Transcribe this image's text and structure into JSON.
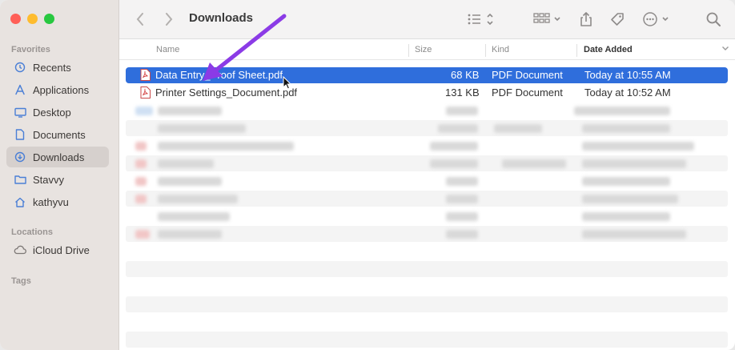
{
  "window": {
    "title": "Downloads"
  },
  "colors": {
    "selection": "#2f6edc",
    "arrow": "#8b3be6"
  },
  "sidebar": {
    "favorites_title": "Favorites",
    "favorites": [
      {
        "label": "Recents",
        "icon": "clock-icon"
      },
      {
        "label": "Applications",
        "icon": "applications-icon"
      },
      {
        "label": "Desktop",
        "icon": "desktop-icon"
      },
      {
        "label": "Documents",
        "icon": "document-icon"
      },
      {
        "label": "Downloads",
        "icon": "download-icon",
        "selected": true
      },
      {
        "label": "Stavvy",
        "icon": "folder-icon"
      },
      {
        "label": "kathyvu",
        "icon": "home-icon"
      }
    ],
    "locations_title": "Locations",
    "locations": [
      {
        "label": "iCloud Drive",
        "icon": "cloud-icon"
      }
    ],
    "tags_title": "Tags"
  },
  "columns": {
    "name": "Name",
    "size": "Size",
    "kind": "Kind",
    "date_added": "Date Added"
  },
  "files": [
    {
      "name": "Data Entry_Proof Sheet.pdf",
      "size": "68 KB",
      "kind": "PDF Document",
      "date_added": "Today at 10:55 AM",
      "selected": true
    },
    {
      "name": "Printer Settings_Document.pdf",
      "size": "131 KB",
      "kind": "PDF Document",
      "date_added": "Today at 10:52 AM",
      "selected": false
    }
  ]
}
